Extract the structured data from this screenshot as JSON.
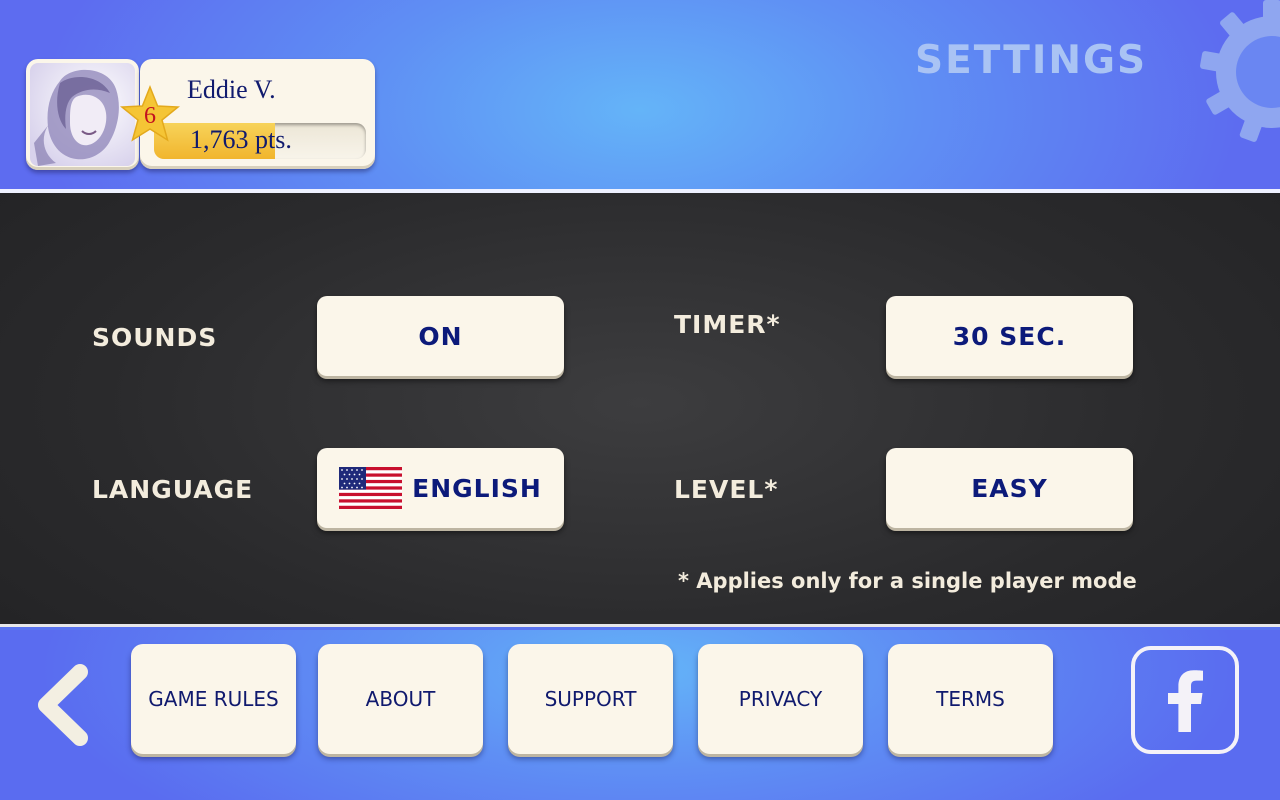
{
  "header": {
    "title": "SETTINGS",
    "player": {
      "name": "Eddie V.",
      "level": "6",
      "points": "1,763 pts.",
      "level_progress": 0.57
    }
  },
  "settings": {
    "sounds": {
      "label": "SOUNDS",
      "value": "ON"
    },
    "timer": {
      "label": "TIMER*",
      "value": "30 SEC."
    },
    "language": {
      "label": "LANGUAGE",
      "value": "ENGLISH",
      "flag": "us-flag-icon"
    },
    "level": {
      "label": "LEVEL*",
      "value": "EASY"
    },
    "footnote": "* Applies only for a single player mode"
  },
  "footer": {
    "back_icon": "chevron-left-icon",
    "nav": [
      {
        "label": "GAME RULES"
      },
      {
        "label": "ABOUT"
      },
      {
        "label": "SUPPORT"
      },
      {
        "label": "PRIVACY"
      },
      {
        "label": "TERMS"
      }
    ],
    "social_icon": "facebook-icon"
  },
  "colors": {
    "header_blue": "#5d6cf0",
    "header_glow": "#64b4f8",
    "panel_dark": "#2a2a2c",
    "button_cream": "#fbf6ea",
    "button_text_navy": "#0c1a7a",
    "label_cream": "#f3ecdd",
    "star_gold": "#f5c535",
    "level_red": "#c3121f"
  }
}
